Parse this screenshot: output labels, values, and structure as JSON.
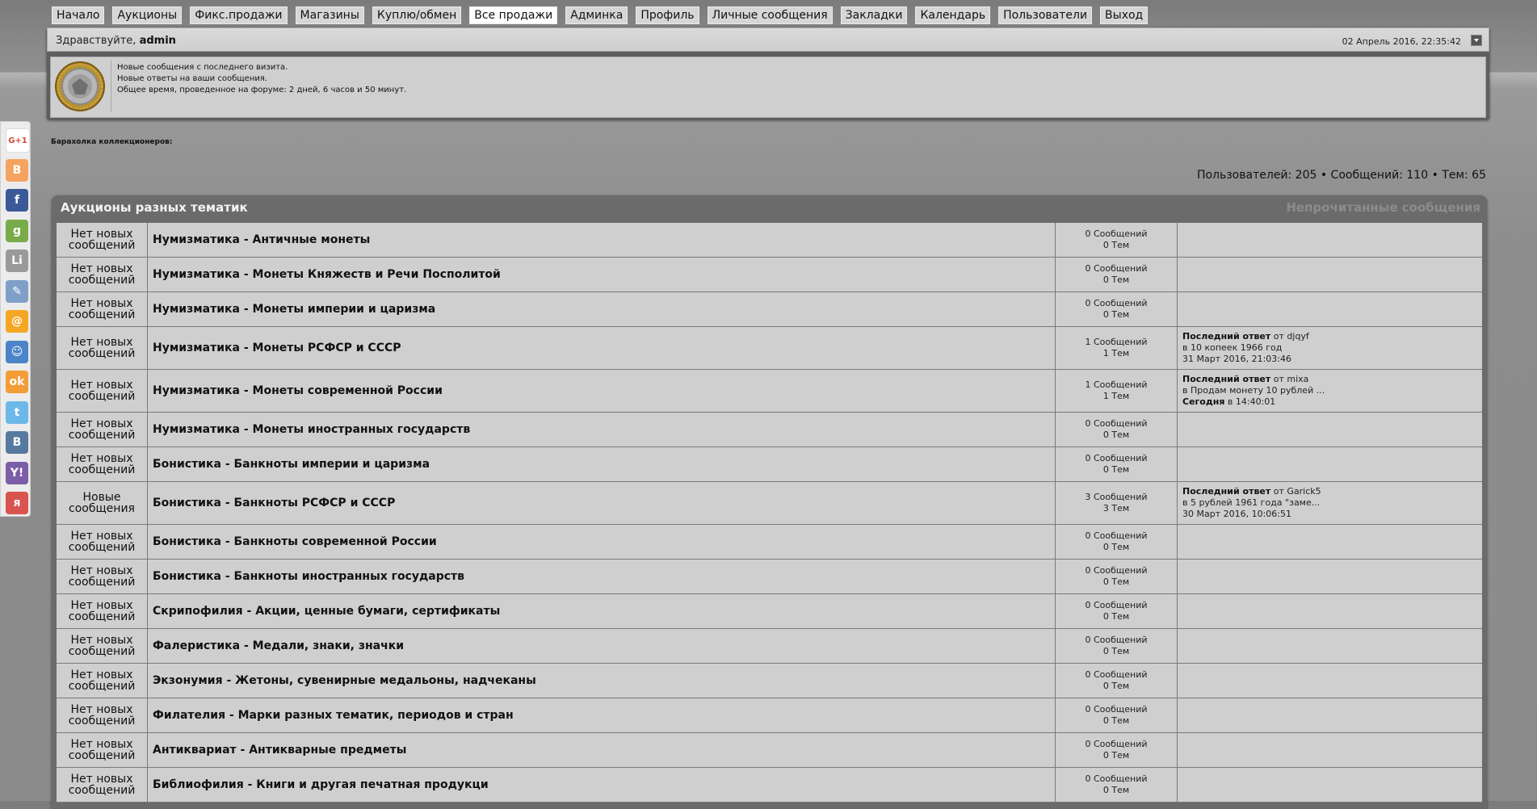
{
  "nav": [
    "Начало",
    "Аукционы",
    "Фикс.продажи",
    "Магазины",
    "Куплю/обмен",
    "Все продажи",
    "Админка",
    "Профиль",
    "Личные сообщения",
    "Закладки",
    "Календарь",
    "Пользователи",
    "Выход"
  ],
  "nav_active": 5,
  "welcome": {
    "greeting_prefix": "Здравствуйте,",
    "username": "admin",
    "datetime": "02 Апрель 2016, 22:35:42",
    "lines": [
      "Новые сообщения с последнего визита.",
      "Новые ответы на ваши сообщения.",
      "Общее время, проведенное на форуме: 2 дней, 6 часов и 50 минут."
    ]
  },
  "social_icons": [
    {
      "name": "google-plus-icon",
      "glyph": "G+1",
      "color": "#d34836"
    },
    {
      "name": "blogger-icon",
      "glyph": "B",
      "color": "#f4a460"
    },
    {
      "name": "facebook-icon",
      "glyph": "f",
      "color": "#3b5998"
    },
    {
      "name": "google-icon",
      "glyph": "g",
      "color": "#7aab4a"
    },
    {
      "name": "liveinternet-icon",
      "glyph": "Li",
      "color": "#9a9a9a"
    },
    {
      "name": "livejournal-icon",
      "glyph": "✎",
      "color": "#7f9fc9"
    },
    {
      "name": "mailru-icon",
      "glyph": "@",
      "color": "#f5a623"
    },
    {
      "name": "myworld-icon",
      "glyph": "☺",
      "color": "#4b84c8"
    },
    {
      "name": "odnoklassniki-icon",
      "glyph": "ok",
      "color": "#f29d38"
    },
    {
      "name": "twitter-icon",
      "glyph": "t",
      "color": "#6cb8e8"
    },
    {
      "name": "vkontakte-icon",
      "glyph": "B",
      "color": "#56799e"
    },
    {
      "name": "yahoo-icon",
      "glyph": "Y!",
      "color": "#7b5ea7"
    },
    {
      "name": "yaru-icon",
      "glyph": "я",
      "color": "#d9534f"
    }
  ],
  "forum_desc": "Барахолка коллекционеров:",
  "stats": "Пользователей: 205  •  Сообщений: 110  •  Тем: 65",
  "category": {
    "title": "Аукционы разных тематик",
    "unread_link": "Непрочитанные сообщения"
  },
  "forums": [
    {
      "status": "Нет новых сообщений",
      "name": "Нумизматика - Античные монеты",
      "posts": "0 Сообщений",
      "topics": "0 Тем",
      "last": null
    },
    {
      "status": "Нет новых сообщений",
      "name": "Нумизматика - Монеты Княжеств и Речи Посполитой",
      "posts": "0 Сообщений",
      "topics": "0 Тем",
      "last": null
    },
    {
      "status": "Нет новых сообщений",
      "name": "Нумизматика - Монеты империи и царизма",
      "posts": "0 Сообщений",
      "topics": "0 Тем",
      "last": null
    },
    {
      "status": "Нет новых сообщений",
      "name": "Нумизматика - Монеты РСФСР и СССР",
      "posts": "1 Сообщений",
      "topics": "1 Тем",
      "last": {
        "label": "Последний ответ",
        "by": "от djqyf",
        "topic": "в 10 копеек 1966 год",
        "date_bold": "",
        "date": "31 Март 2016, 21:03:46"
      }
    },
    {
      "status": "Нет новых сообщений",
      "name": "Нумизматика - Монеты современной России",
      "posts": "1 Сообщений",
      "topics": "1 Тем",
      "last": {
        "label": "Последний ответ",
        "by": "от mixa",
        "topic": "в Продам монету 10 рублей ...",
        "date_bold": "Сегодня",
        "date": "в 14:40:01"
      }
    },
    {
      "status": "Нет новых сообщений",
      "name": "Нумизматика - Монеты иностранных государств",
      "posts": "0 Сообщений",
      "topics": "0 Тем",
      "last": null
    },
    {
      "status": "Нет новых сообщений",
      "name": "Бонистика - Банкноты империи и царизма",
      "posts": "0 Сообщений",
      "topics": "0 Тем",
      "last": null
    },
    {
      "status": "Новые сообщения",
      "name": "Бонистика - Банкноты РСФСР и СССР",
      "posts": "3 Сообщений",
      "topics": "3 Тем",
      "last": {
        "label": "Последний ответ",
        "by": "от Garick5",
        "topic": "в 5 рублей 1961 года \"заме...",
        "date_bold": "",
        "date": "30 Март 2016, 10:06:51"
      }
    },
    {
      "status": "Нет новых сообщений",
      "name": "Бонистика - Банкноты современной России",
      "posts": "0 Сообщений",
      "topics": "0 Тем",
      "last": null
    },
    {
      "status": "Нет новых сообщений",
      "name": "Бонистика - Банкноты иностранных государств",
      "posts": "0 Сообщений",
      "topics": "0 Тем",
      "last": null
    },
    {
      "status": "Нет новых сообщений",
      "name": "Скрипофилия - Акции, ценные бумаги, сертификаты",
      "posts": "0 Сообщений",
      "topics": "0 Тем",
      "last": null
    },
    {
      "status": "Нет новых сообщений",
      "name": "Фалеристика - Медали, знаки, значки",
      "posts": "0 Сообщений",
      "topics": "0 Тем",
      "last": null
    },
    {
      "status": "Нет новых сообщений",
      "name": "Экзонумия - Жетоны, сувенирные медальоны, надчеканы",
      "posts": "0 Сообщений",
      "topics": "0 Тем",
      "last": null
    },
    {
      "status": "Нет новых сообщений",
      "name": "Филателия - Марки разных тематик, периодов и стран",
      "posts": "0 Сообщений",
      "topics": "0 Тем",
      "last": null
    },
    {
      "status": "Нет новых сообщений",
      "name": "Антиквариат - Антикварные предметы",
      "posts": "0 Сообщений",
      "topics": "0 Тем",
      "last": null
    },
    {
      "status": "Нет новых сообщений",
      "name": "Библиофилия - Книги и другая печатная продукци",
      "posts": "0 Сообщений",
      "topics": "0 Тем",
      "last": null
    }
  ]
}
